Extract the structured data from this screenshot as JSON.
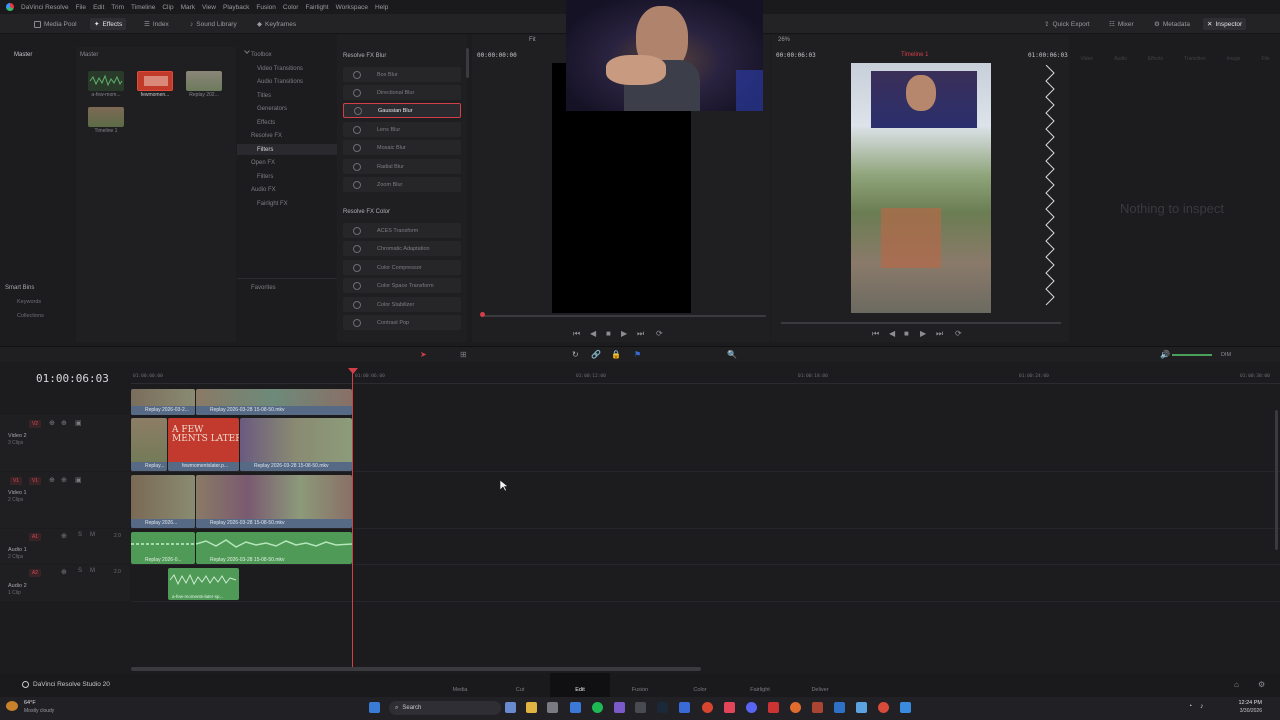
{
  "menubar": {
    "app_name": "DaVinci Resolve",
    "items": [
      "File",
      "Edit",
      "Trim",
      "Timeline",
      "Clip",
      "Mark",
      "View",
      "Playback",
      "Fusion",
      "Color",
      "Fairlight",
      "Workspace",
      "Help"
    ]
  },
  "toolbar": {
    "media_pool": "Media Pool",
    "effects": "Effects",
    "index": "Index",
    "sound_library": "Sound Library",
    "keyframes": "Keyframes",
    "quick_export": "Quick Export",
    "mixer": "Mixer",
    "metadata": "Metadata",
    "inspector": "Inspector"
  },
  "media_pool": {
    "master_left": "Master",
    "master_right": "Master",
    "clips": [
      {
        "label": "a-few-mom..."
      },
      {
        "label": "fewmomen..."
      },
      {
        "label": "Replay 202..."
      },
      {
        "label": "Timeline 1"
      }
    ],
    "smart_bins": "Smart Bins",
    "keywords": "Keywords",
    "collections": "Collections"
  },
  "effects_tree": {
    "toolbox": "Toolbox",
    "video_transitions": "Video Transitions",
    "audio_transitions": "Audio Transitions",
    "titles": "Titles",
    "generators": "Generators",
    "effects": "Effects",
    "resolve_fx": "Resolve FX",
    "filters": "Filters",
    "open_fx": "Open FX",
    "open_filters": "Filters",
    "audio_fx": "Audio FX",
    "fairlight_fx": "Fairlight FX",
    "favorites": "Favorites"
  },
  "fx_list": {
    "blur_header": "Resolve FX Blur",
    "blur_items": [
      "Box Blur",
      "Directional Blur",
      "Gaussian Blur",
      "Lens Blur",
      "Mosaic Blur",
      "Radial Blur",
      "Zoom Blur"
    ],
    "color_header": "Resolve FX Color",
    "color_items": [
      "ACES Transform",
      "Chromatic Adaptation",
      "Color Compressor",
      "Color Space Transform",
      "Color Stabilizer",
      "Contrast Pop"
    ]
  },
  "viewers": {
    "source_timecode": "00:00:00:00",
    "fit": "Fit",
    "zoom": "26%",
    "program_timecode_left": "00:00:06:03",
    "timeline_name": "Timeline 1",
    "program_timecode_right": "01:00:06:03"
  },
  "inspector": {
    "empty_message": "Nothing to inspect",
    "tabs": [
      "Video",
      "Audio",
      "Effects",
      "Transition",
      "Image",
      "File"
    ]
  },
  "timeline": {
    "current_timecode": "01:00:06:03",
    "ruler": [
      "01:00:00:00",
      "01:00:06:00",
      "01:00:12:00",
      "01:00:18:00",
      "01:00:24:00",
      "01:00:30:00"
    ],
    "dim_label": "DIM",
    "tracks": [
      {
        "id": "V2",
        "name": "Video 2",
        "sub": "3 Clips"
      },
      {
        "id": "V1",
        "name": "Video 1",
        "sub": "2 Clips"
      },
      {
        "id": "A1",
        "name": "Audio 1",
        "sub": "2 Clips",
        "level": "2.0"
      },
      {
        "id": "A2",
        "name": "Audio 2",
        "sub": "1 Clip",
        "level": "2.0"
      }
    ],
    "clips": {
      "top_a": "Replay 2026-03-2...",
      "top_b": "Replay 2026-03-28 15-08-50.mkv",
      "v2_a": "Replay...",
      "v2_b": "fewmomentslater.p...",
      "v2_c": "Replay 2026-03-28 15-08-50.mkv",
      "v2_title_art": "A FEW\nMENTS LATER",
      "v1_a": "Replay 2026...",
      "v1_b": "Replay 2026-03-28 15-08-50.mkv",
      "a1_a": "Replay 2026-0...",
      "a1_b": "Replay 2026-03-28 15-08-50.mkv",
      "a2_a": "a-few-moments-later-sp..."
    }
  },
  "pages": {
    "brand": "DaVinci Resolve Studio 20",
    "tabs": [
      "Media",
      "Cut",
      "Edit",
      "Fusion",
      "Color",
      "Fairlight",
      "Deliver"
    ],
    "active": "Edit"
  },
  "taskbar": {
    "weather_temp": "64°F",
    "weather_desc": "Mostly cloudy",
    "search": "Search",
    "time": "12:24 PM",
    "date": "3/30/2026"
  },
  "colors": {
    "accent_red": "#d33f49",
    "clip_blue": "#566a86",
    "audio_green": "#4e9a56"
  }
}
